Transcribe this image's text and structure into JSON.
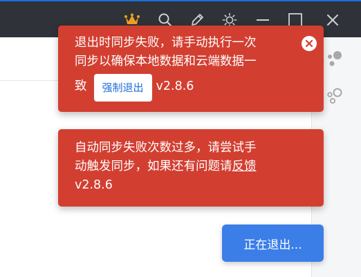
{
  "titlebar": {
    "icons": [
      "crown-icon",
      "search-icon",
      "pen-icon",
      "sun-icon",
      "minimize-icon",
      "maximize-icon",
      "close-icon"
    ],
    "crown_color": "#f0a020"
  },
  "dock": {
    "icons": [
      "bubbles-icon",
      "rings-icon"
    ]
  },
  "toasts": [
    {
      "line1": "退出时同步失败，请手动执行一次",
      "line2": "同步以确保本地数据和云端数据一",
      "line3_prefix": "致",
      "button_label": "强制退出",
      "version": "v2.8.6",
      "color": "#d23f31"
    },
    {
      "line1": "自动同步失败次数过多，请尝试手",
      "line2_prefix": "动触发同步，如果还有问题请",
      "link_label": "反馈",
      "version": "v2.8.6",
      "color": "#d23f31"
    }
  ],
  "status": {
    "label": "正在退出...",
    "color": "#3b7ee8"
  }
}
